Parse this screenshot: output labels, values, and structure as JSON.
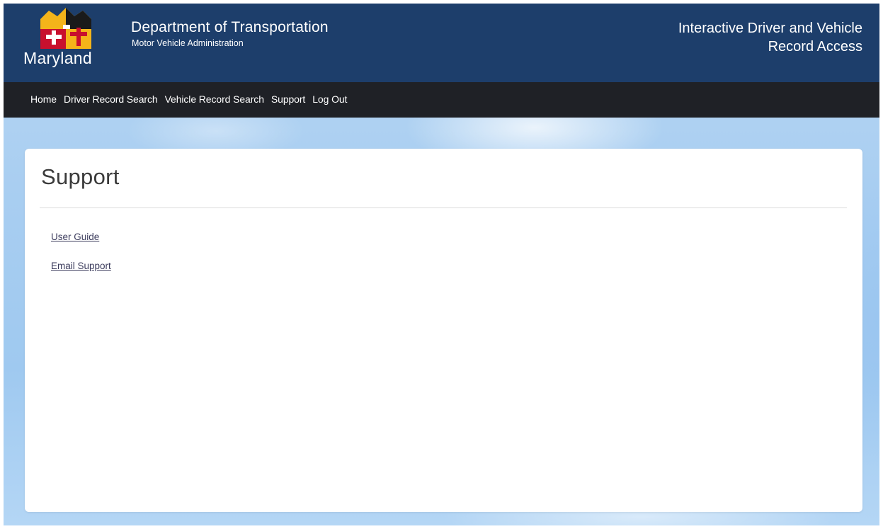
{
  "header": {
    "logo_word": "Maryland",
    "dept_title": "Department of Transportation",
    "dept_subtitle": "Motor Vehicle Administration",
    "app_title_line1": "Interactive Driver and Vehicle",
    "app_title_line2": "Record Access",
    "colors": {
      "header_bg": "#1d3e6b",
      "flag_gold": "#f4b41a",
      "flag_red": "#c8102e",
      "flag_black": "#1a1a1a"
    }
  },
  "nav": {
    "items": [
      {
        "label": "Home"
      },
      {
        "label": "Driver Record Search"
      },
      {
        "label": "Vehicle Record Search"
      },
      {
        "label": "Support"
      },
      {
        "label": "Log Out"
      }
    ]
  },
  "main": {
    "title": "Support",
    "links": [
      {
        "label": "User Guide"
      },
      {
        "label": "Email Support"
      }
    ]
  }
}
